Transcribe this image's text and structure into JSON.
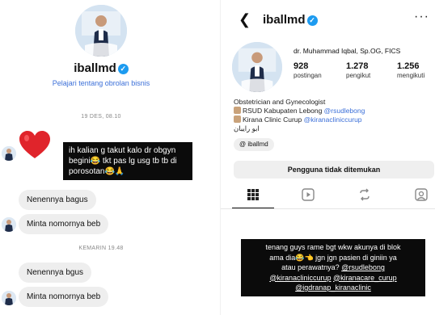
{
  "left": {
    "username": "iballmd",
    "business_link": "Pelajari tentang obrolan bisnis",
    "timestamps": [
      "19 DES, 08.10",
      "KEMARIN 19.48"
    ],
    "story_lines": [
      "ih kalian g takut kalo dr obgyn",
      "begini😂 tkt pas lg usg tb tb di",
      "porosotan😂🙏"
    ],
    "messages": [
      "Nenennya bagus",
      "Minta nomornya beb",
      "Nenennya bgus",
      "Minta nomornya beb"
    ]
  },
  "right": {
    "username": "iballmd",
    "profile_name": "dr. Muhammad Iqbal, Sp.OG, FICS",
    "stats": [
      {
        "value": "928",
        "label": "postingan"
      },
      {
        "value": "1.278",
        "label": "pengikut"
      },
      {
        "value": "1.256",
        "label": "mengikuti"
      }
    ],
    "bio_role": "Obstetrician and Gynecologist",
    "bio_line1_text": "RSUD Kabupaten Lebong ",
    "bio_line1_link": "@rsudlebong",
    "bio_line2_text": "Kirana Clinic Curup ",
    "bio_line2_link": "@kiranacliniccurup",
    "bio_arabic": "ابو رايبان",
    "threads_label": "iballmd",
    "not_found": "Pengguna tidak ditemukan",
    "story_lines": [
      "tenang guys rame bgt wkw akunya di blok",
      "ama dia😂👈 jgn jgn pasien di giniin ya",
      "atau perawatnya?"
    ],
    "story_mentions": [
      "@rsudlebong",
      "@kiranacliniccurup",
      "@kiranacare_curup",
      "@igdranap_kiranaclinic"
    ]
  },
  "icons": {
    "verified": "verified-badge-icon",
    "back": "back-arrow-icon",
    "more": "more-icon",
    "threads": "threads-icon",
    "tabs": [
      "grid-icon",
      "reels-icon",
      "repost-icon",
      "tagged-icon"
    ]
  },
  "colors": {
    "verified": "#1d9bf0",
    "link": "#3b6fd8",
    "story_bg": "#0b0b0b",
    "bubble": "#eeeeee"
  }
}
